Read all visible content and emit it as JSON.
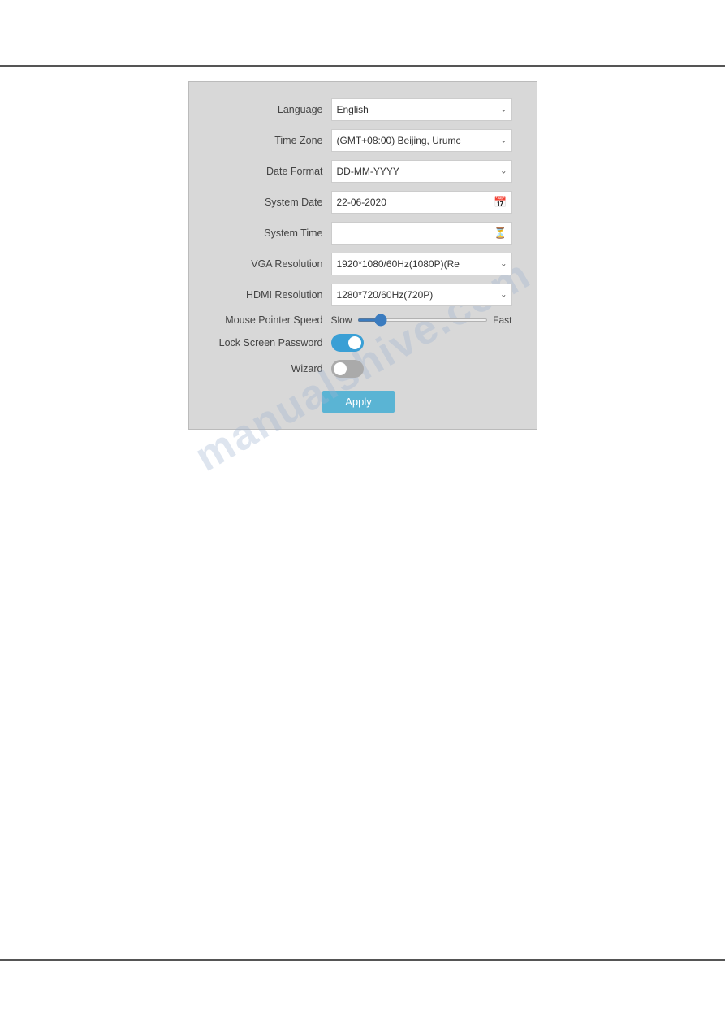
{
  "page": {
    "watermark": "manualshive.com"
  },
  "form": {
    "language_label": "Language",
    "language_value": "English",
    "timezone_label": "Time Zone",
    "timezone_value": "(GMT+08:00) Beijing, Urumc",
    "date_format_label": "Date Format",
    "date_format_value": "DD-MM-YYYY",
    "system_date_label": "System Date",
    "system_date_value": "22-06-2020",
    "system_time_label": "System Time",
    "system_time_value": "",
    "vga_resolution_label": "VGA Resolution",
    "vga_resolution_value": "1920*1080/60Hz(1080P)(Re",
    "hdmi_resolution_label": "HDMI Resolution",
    "hdmi_resolution_value": "1280*720/60Hz(720P)",
    "mouse_pointer_speed_label": "Mouse Pointer Speed",
    "slider_slow": "Slow",
    "slider_fast": "Fast",
    "lock_screen_password_label": "Lock Screen Password",
    "wizard_label": "Wizard",
    "apply_label": "Apply"
  }
}
